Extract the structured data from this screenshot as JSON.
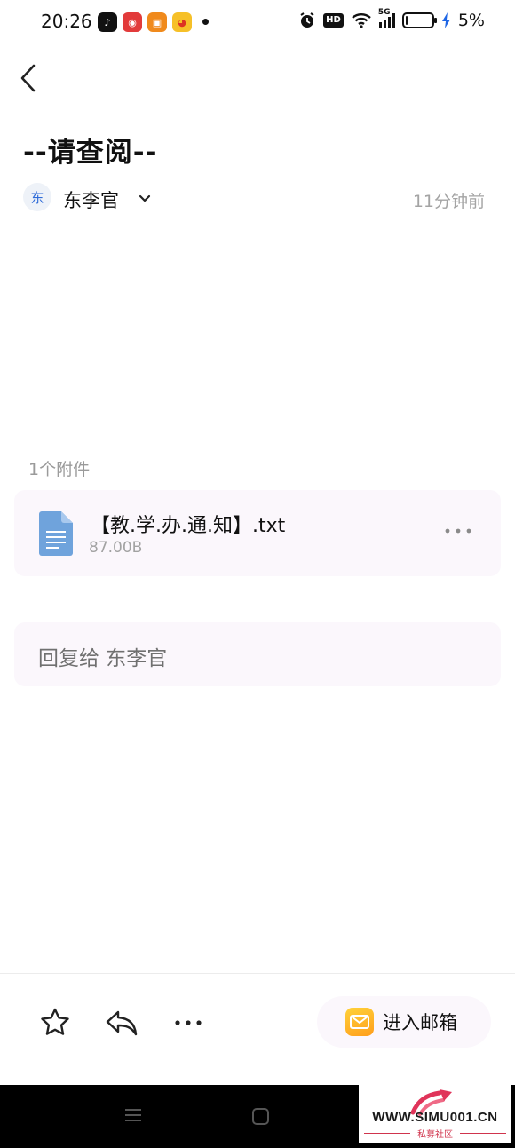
{
  "status_bar": {
    "time": "20:26",
    "battery": "5%",
    "battery_fraction": 0.05,
    "hd": "HD",
    "network": "5G",
    "apps": [
      "tiktok-icon",
      "bubble-app-icon",
      "orange-app-icon",
      "weibo-icon"
    ]
  },
  "mail": {
    "title": "--请查阅--",
    "sender_initial": "东",
    "sender_name": "东李官",
    "sent_time": "11分钟前"
  },
  "attachments": {
    "count_label": "1个附件",
    "items": [
      {
        "name": "【教.学.办.通.知】.txt",
        "size": "87.00B"
      }
    ]
  },
  "reply": {
    "placeholder": "回复给 东李官"
  },
  "toolbar": {
    "open_mailbox_label": "进入邮箱"
  },
  "watermark": {
    "site": "WWW.SIMU001.CN",
    "subtitle": "私募社区"
  },
  "colors": {
    "accent_blue": "#2e6bd8",
    "card_bg": "#fbf7fc",
    "file_icon": "#6fa3dc",
    "mailbox_icon": "#ffb82a",
    "muted_text": "#a4a4a4"
  }
}
